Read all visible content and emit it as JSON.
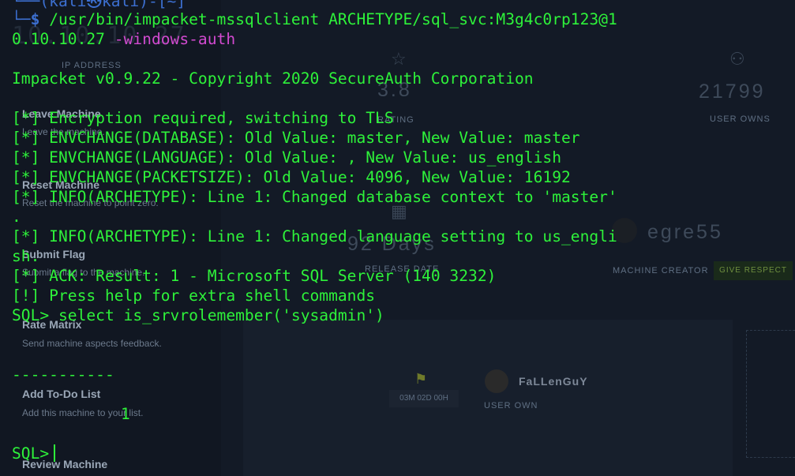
{
  "background": {
    "ip_big": "10.10.10.27",
    "ip_label": "IP ADDRESS",
    "rating": "3.8",
    "rating_label": "RATING",
    "user_owns_count": "21799",
    "user_owns_label": "USER OWNS",
    "release_days": "92 Days",
    "release_label": "RELEASE DATE",
    "creator_name": "egre55",
    "creator_label": "MACHINE CREATOR",
    "respect_button": "GIVE RESPECT",
    "actions": [
      {
        "title": "Leave Machine",
        "desc": "Leave the machine."
      },
      {
        "title": "Reset Machine",
        "desc": "Reset the machine to point zero."
      },
      {
        "title": "Submit Flag",
        "desc": "Submit a flag to the machine."
      },
      {
        "title": "Rate Matrix",
        "desc": "Send machine aspects feedback."
      },
      {
        "title": "Add To-Do List",
        "desc": "Add this machine to your list."
      },
      {
        "title": "Review Machine",
        "desc": ""
      }
    ],
    "own_timer": "03M 02D 00H",
    "owner_name": "FaLLenGuY",
    "owner_label": "USER OWN",
    "colors": {
      "page": "#0d121b",
      "respect_green": "#6f8f3f"
    }
  },
  "terminal": {
    "prompt_top": "└──(kali㉿kali)-[~]",
    "prompt_symbol": "$",
    "command": "/usr/bin/impacket-mssqlclient ARCHETYPE/sql_svc:M3g4c0rp123@1",
    "command_wrap": "0.10.10.27",
    "command_flag": "-windows-auth",
    "banner": "Impacket v0.9.22 - Copyright 2020 SecureAuth Corporation",
    "output": [
      "[*] Encryption required, switching to TLS",
      "[*] ENVCHANGE(DATABASE): Old Value: master, New Value: master",
      "[*] ENVCHANGE(LANGUAGE): Old Value: , New Value: us_english",
      "[*] ENVCHANGE(PACKETSIZE): Old Value: 4096, New Value: 16192",
      "[*] INFO(ARCHETYPE): Line 1: Changed database context to 'master'",
      ".",
      "[*] INFO(ARCHETYPE): Line 1: Changed language setting to us_engli",
      "sh.",
      "[*] ACK: Result: 1 - Microsoft SQL Server (140 3232)",
      "[!] Press help for extra shell commands"
    ],
    "sql_query": "SQL> select is_srvrolemember('sysadmin')",
    "result_divider": "-----------",
    "result_value": "1",
    "sql_prompt": "SQL>",
    "colors": {
      "text": "#2ef23a",
      "prompt": "#3c6fd0",
      "flag": "#d24ad0"
    }
  }
}
